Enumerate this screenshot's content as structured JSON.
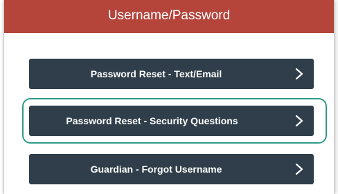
{
  "header": {
    "title": "Username/Password",
    "color": "#b5443b"
  },
  "buttons": [
    {
      "label": "Password Reset - Text/Email",
      "icon": "chevron-right-icon"
    },
    {
      "label": "Password Reset - Security Questions",
      "icon": "chevron-right-icon"
    },
    {
      "label": "Guardian - Forgot Username",
      "icon": "chevron-right-icon"
    }
  ],
  "colors": {
    "button_bg": "#2f3e4a",
    "highlight_ring": "#2e9b8b"
  }
}
